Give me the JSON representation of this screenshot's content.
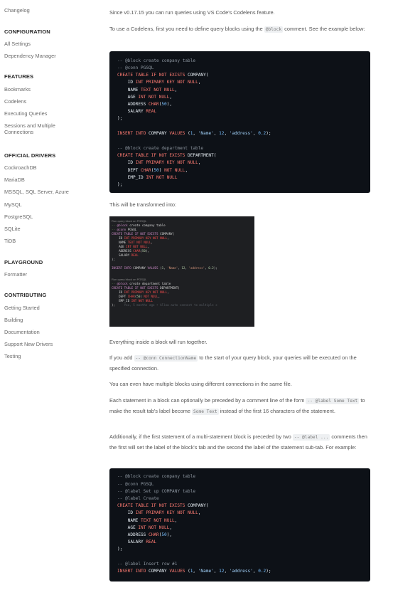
{
  "sidebar": {
    "top_link": "Changelog",
    "sections": [
      {
        "title": "CONFIGURATION",
        "items": [
          "All Settings",
          "Dependency Manager"
        ]
      },
      {
        "title": "FEATURES",
        "items": [
          "Bookmarks",
          "Codelens",
          "Executing Queries",
          "Sessions and Multiple Connections"
        ]
      },
      {
        "title": "OFFICIAL DRIVERS",
        "items": [
          "CockroachDB",
          "MariaDB",
          "MSSQL, SQL Server, Azure",
          "MySQL",
          "PostgreSQL",
          "SQLite",
          "TiDB"
        ]
      },
      {
        "title": "PLAYGROUND",
        "items": [
          "Formatter"
        ]
      },
      {
        "title": "CONTRIBUTING",
        "items": [
          "Getting Started",
          "Building",
          "Documentation",
          "Support New Drivers",
          "Testing"
        ]
      }
    ]
  },
  "content": {
    "p1": "Since v0.17.15 you can run queries using VS Code's Codelens feature.",
    "p2_a": "To use a Codelens, first you need to define query blocks using the ",
    "p2_code": "@block",
    "p2_b": " comment. See the example below:",
    "p3": "This will be transformed into:",
    "p4": "Everything inside a block will run together.",
    "p5_a": "If you add ",
    "p5_code": "-- @conn ConnectionName",
    "p5_b": " to the start of your query block, your queries will be executed on the specified connection.",
    "p6": "You can even have multiple blocks using different connections in the same file.",
    "p7_a": "Each statement in a block can optionally be preceded by a comment line of the form ",
    "p7_code1": "-- @label Some Text",
    "p7_b": " to make the result tab's label become ",
    "p7_code2": "Some Text",
    "p7_c": " instead of the first 16 characters of the statement.",
    "p8_a": "Additionally, if the first statement of a multi-statement block is preceded by two ",
    "p8_code": "-- @label ...",
    "p8_b": " comments then the first will set the label of the block's tab and the second the label of the statement sub-tab. For example:"
  },
  "code1": {
    "l1": "-- @block create company table",
    "l2": "-- @conn PGSQL",
    "l3_kw": "CREATE TABLE IF NOT EXISTS",
    "l3_rest": " COMPANY(",
    "l4_a": "    ID ",
    "l4_kw": "INT PRIMARY KEY NOT NULL",
    "l5_a": "    NAME ",
    "l5_kw": "TEXT NOT NULL",
    "l6_a": "    AGE ",
    "l6_kw": "INT NOT NULL",
    "l7_a": "    ADDRESS ",
    "l7_kw": "CHAR",
    "l7_n": "50",
    "l8_a": "    SALARY ",
    "l8_kw": "REAL",
    "l9": ");",
    "l10_kw1": "INSERT INTO",
    "l10_a": " COMPANY ",
    "l10_kw2": "VALUES",
    "l10_n1": "1",
    "l10_s1": "'Name'",
    "l10_n2": "12",
    "l10_s2": "'address'",
    "l10_n3": "0.2",
    "l11": "-- @block create department table",
    "l12_kw": "CREATE TABLE IF NOT EXISTS",
    "l12_rest": " DEPARTMENT(",
    "l13_a": "    ID ",
    "l13_kw": "INT PRIMARY KEY NOT NULL",
    "l14_a": "    DEPT ",
    "l14_kw1": "CHAR",
    "l14_n": "50",
    "l14_kw2": "NOT NULL",
    "l15_a": "    EMP_ID ",
    "l15_kw": "INT NOT NULL",
    "l16": ");"
  },
  "shot": {
    "lens1": "Run query block on PGSQL",
    "a1": "-- ",
    "a1b": "@block",
    "a1c": " create company table",
    "a2": "-- ",
    "a2b": "@conn",
    "a2c": " PGSQL",
    "a3_kw": "CREATE TABLE IF NOT EXISTS",
    "a3_r": " COMPANY(",
    "a4_a": "    ID ",
    "a4_kw": "INT PRIMARY KEY NOT NULL",
    "a5_a": "    NAME ",
    "a5_kw": "TEXT NOT NULL",
    "a6_a": "    AGE ",
    "a6_kw": "INT NOT NULL",
    "a7_a": "    ADDRESS ",
    "a7_kw": "CHAR",
    "a7_n": "50",
    "a8_a": "    SALARY ",
    "a8_kw": "REAL",
    "a9": ");",
    "a10_kw": "INSERT INTO",
    "a10_a": " COMPANY ",
    "a10_kw2": "VALUES",
    "a10_n1": "1",
    "a10_s1": "'Name'",
    "a10_n2": "12",
    "a10_s2": "'address'",
    "a10_n3": "0.2",
    "lens2": "Run query block on PGSQL",
    "b1": "-- ",
    "b1b": "@block",
    "b1c": " create department table",
    "b2_kw": "CREATE TABLE IF NOT EXISTS",
    "b2_r": " DEPARTMENT(",
    "b3_a": "    ID ",
    "b3_kw": "INT PRIMARY KEY NOT NULL",
    "b4_a": "    DEPT ",
    "b4_kw": "CHAR",
    "b4_n": "50",
    "b4_kw2": "NOT NULL",
    "b5_a": "    EMP_ID ",
    "b5_kw": "INT NOT NULL",
    "b6": ");",
    "b6_ghost": "     You, 5 months ago • Allow auto connect to multiple c"
  },
  "code2": {
    "l1": "-- @block create company table",
    "l2": "-- @conn PGSQL",
    "l3": "-- @label Set up COMPANY table",
    "l4": "-- @label Create",
    "l5_kw": "CREATE TABLE IF NOT EXISTS",
    "l5_rest": " COMPANY(",
    "l6_a": "    ID ",
    "l6_kw": "INT PRIMARY KEY NOT NULL",
    "l7_a": "    NAME ",
    "l7_kw": "TEXT NOT NULL",
    "l8_a": "    AGE ",
    "l8_kw": "INT NOT NULL",
    "l9_a": "    ADDRESS ",
    "l9_kw": "CHAR",
    "l9_n": "50",
    "l10_a": "    SALARY ",
    "l10_kw": "REAL",
    "l11": ");",
    "l12": "-- @label Insert row #1",
    "l13_kw1": "INSERT INTO",
    "l13_a": " COMPANY ",
    "l13_kw2": "VALUES",
    "l13_n1": "1",
    "l13_s1": "'Name'",
    "l13_n2": "12",
    "l13_s2": "'address'",
    "l13_n3": "0.2"
  }
}
